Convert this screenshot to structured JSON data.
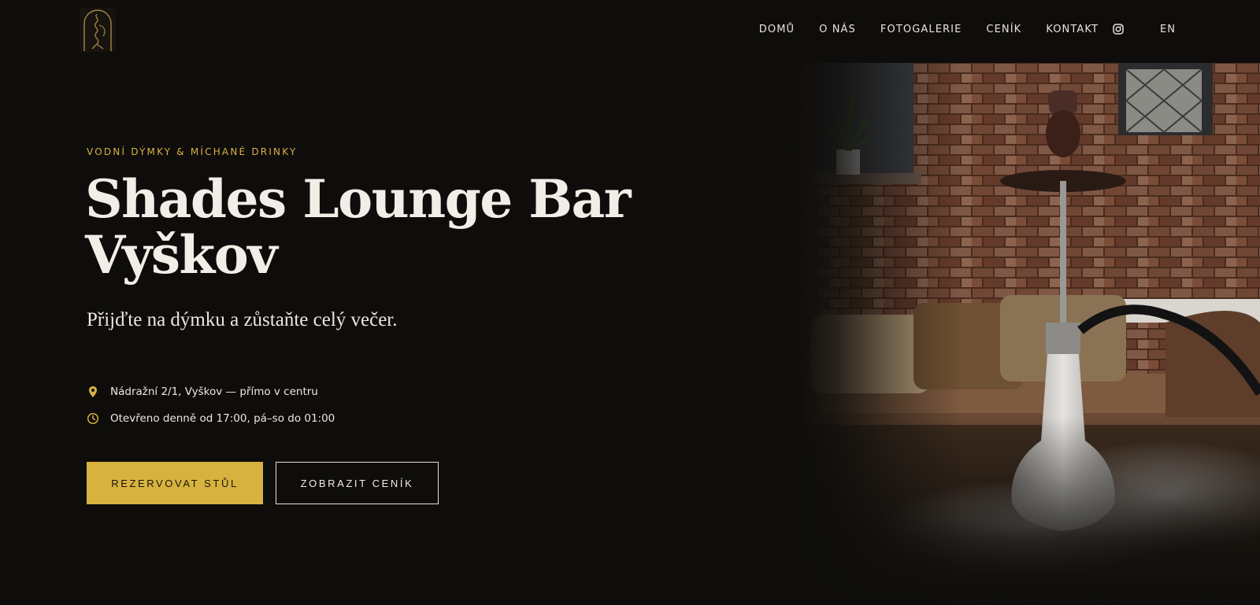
{
  "header": {
    "logo_icon": "hookah-arch-logo",
    "nav": [
      {
        "label": "DOMŮ"
      },
      {
        "label": "O NÁS"
      },
      {
        "label": "FOTOGALERIE"
      },
      {
        "label": "CENÍK"
      },
      {
        "label": "KONTAKT"
      }
    ],
    "social_icon": "instagram-icon",
    "language": "EN"
  },
  "hero": {
    "eyebrow": "VODNÍ DÝMKY & MÍCHANÉ DRINKY",
    "title_line1": "Shades Lounge Bar",
    "title_line2": "Vyškov",
    "subtitle": "Přijďte na dýmku a zůstaňte celý večer.",
    "address": {
      "icon": "location-pin-icon",
      "text": "Nádražní 2/1, Vyškov — přímo v centru"
    },
    "hours": {
      "icon": "clock-icon",
      "text": "Otevřeno denně od 17:00, pá–so do 01:00"
    },
    "primary_button": "REZERVOVAT STŮL",
    "secondary_button": "ZOBRAZIT CENÍK",
    "image": "hookah-lounge-photo"
  },
  "colors": {
    "background": "#0e0d0b",
    "accent": "#d7b23f",
    "text": "#f2eee7"
  }
}
